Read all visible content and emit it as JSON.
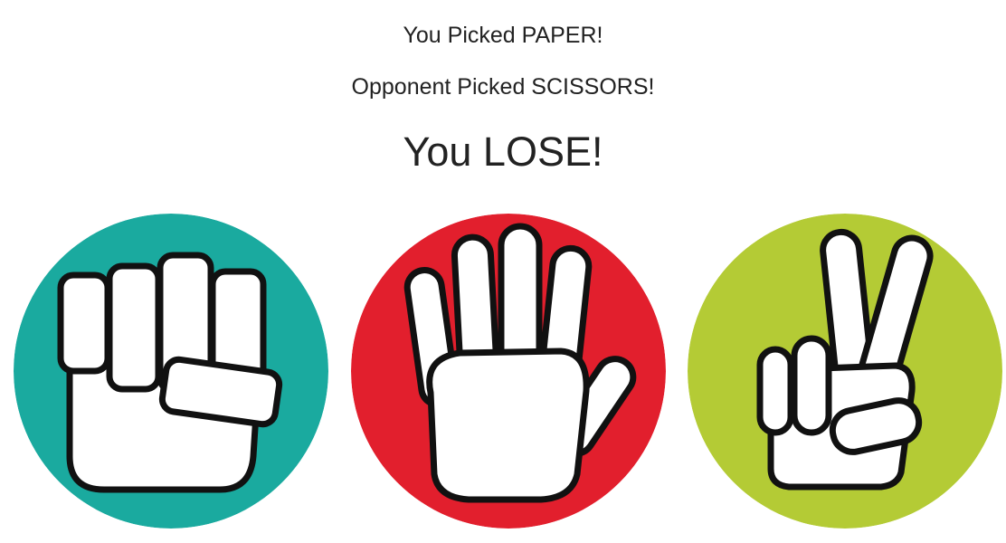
{
  "messages": {
    "you_picked": "You Picked PAPER!",
    "opponent_picked": "Opponent Picked SCISSORS!",
    "result": "You LOSE!"
  },
  "choices": [
    {
      "name": "rock",
      "icon": "fist-icon",
      "color": "#1aaa9f"
    },
    {
      "name": "paper",
      "icon": "open-hand-icon",
      "color": "#e21f2d"
    },
    {
      "name": "scissors",
      "icon": "peace-sign-icon",
      "color": "#b4cb35"
    }
  ]
}
